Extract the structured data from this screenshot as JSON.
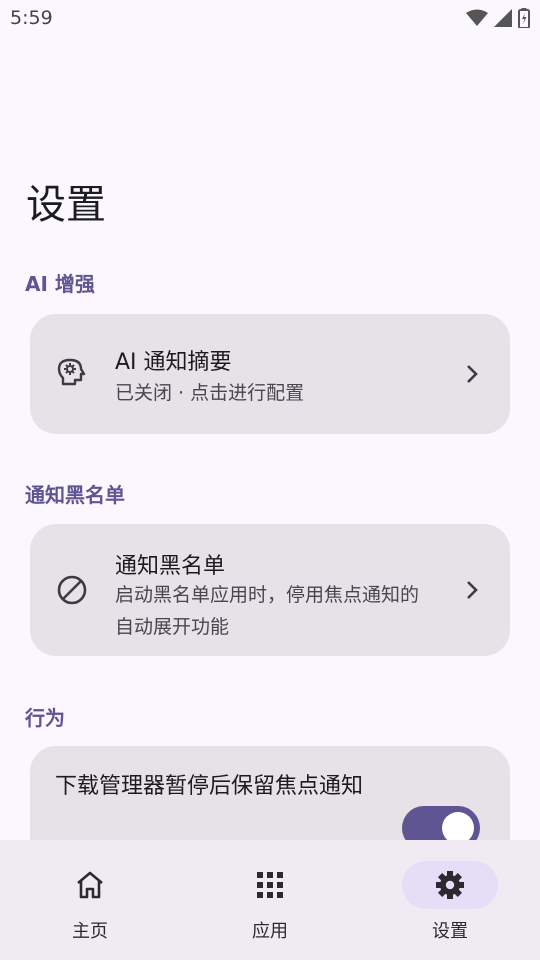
{
  "status_bar": {
    "time": "5:59"
  },
  "page": {
    "title": "设置"
  },
  "sections": {
    "ai": {
      "label": "AI 增强",
      "card": {
        "title": "AI 通知摘要",
        "subtitle": "已关闭 · 点击进行配置"
      }
    },
    "blacklist": {
      "label": "通知黑名单",
      "card": {
        "title": "通知黑名单",
        "subtitle": "启动黑名单应用时，停用焦点通知的自动展开功能"
      }
    },
    "behavior": {
      "label": "行为",
      "card": {
        "title": "下载管理器暂停后保留焦点通知",
        "toggle_on": true
      }
    }
  },
  "bottom_nav": {
    "items": [
      {
        "label": "主页",
        "icon": "home-icon",
        "active": false
      },
      {
        "label": "应用",
        "icon": "apps-grid-icon",
        "active": false
      },
      {
        "label": "设置",
        "icon": "gear-icon",
        "active": true
      }
    ]
  },
  "colors": {
    "accent": "#5e5592",
    "section_label": "#5f5590",
    "card_bg": "#e7e1e8",
    "background": "#fbf7fe"
  }
}
